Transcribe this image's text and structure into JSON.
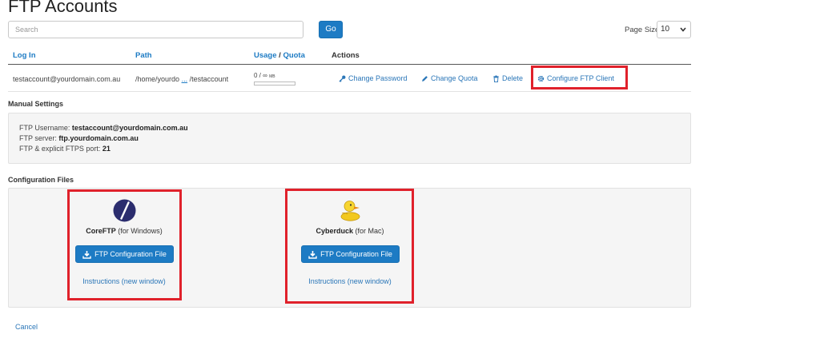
{
  "page": {
    "title": "FTP Accounts"
  },
  "search": {
    "placeholder": "Search",
    "go_label": "Go"
  },
  "pagination": {
    "page_size_label": "Page Size",
    "page_size_value": "10"
  },
  "table": {
    "columns": {
      "login": "Log In",
      "path": "Path",
      "usage": "Usage",
      "usage_sep": " / ",
      "quota": "Quota",
      "actions": "Actions"
    },
    "rows": [
      {
        "login": "testaccount@yourdomain.com.au",
        "path_prefix": "/home/yourdo",
        "path_ellipsis": "...",
        "path_suffix": "/testaccount",
        "usage_value": "0 / ∞",
        "usage_unit": "MB",
        "usage_fraction": 0,
        "actions": {
          "change_password": "Change Password",
          "change_quota": "Change Quota",
          "delete": "Delete",
          "configure": "Configure FTP Client"
        }
      }
    ]
  },
  "manual_settings": {
    "title": "Manual Settings",
    "username_label": "FTP Username:",
    "username": "testaccount@yourdomain.com.au",
    "server_label": "FTP server:",
    "server": "ftp.yourdomain.com.au",
    "port_label": "FTP & explicit FTPS port:",
    "port": "21"
  },
  "config_files": {
    "title": "Configuration Files",
    "clients": [
      {
        "name": "CoreFTP",
        "platform": "(for Windows)",
        "button": "FTP Configuration File",
        "instructions": "Instructions (new window)"
      },
      {
        "name": "Cyberduck",
        "platform": "(for Mac)",
        "button": "FTP Configuration File",
        "instructions": "Instructions (new window)"
      }
    ]
  },
  "footer": {
    "cancel": "Cancel"
  },
  "colors": {
    "primary": "#1d7bc4",
    "link": "#2a76b8",
    "highlight": "#e0212b",
    "panel": "#f5f5f5"
  },
  "icons": [
    "key-icon",
    "pencil-icon",
    "trash-icon",
    "gear-icon",
    "download-icon",
    "coreftp-logo-icon",
    "cyberduck-logo-icon",
    "chevron-down-icon"
  ]
}
